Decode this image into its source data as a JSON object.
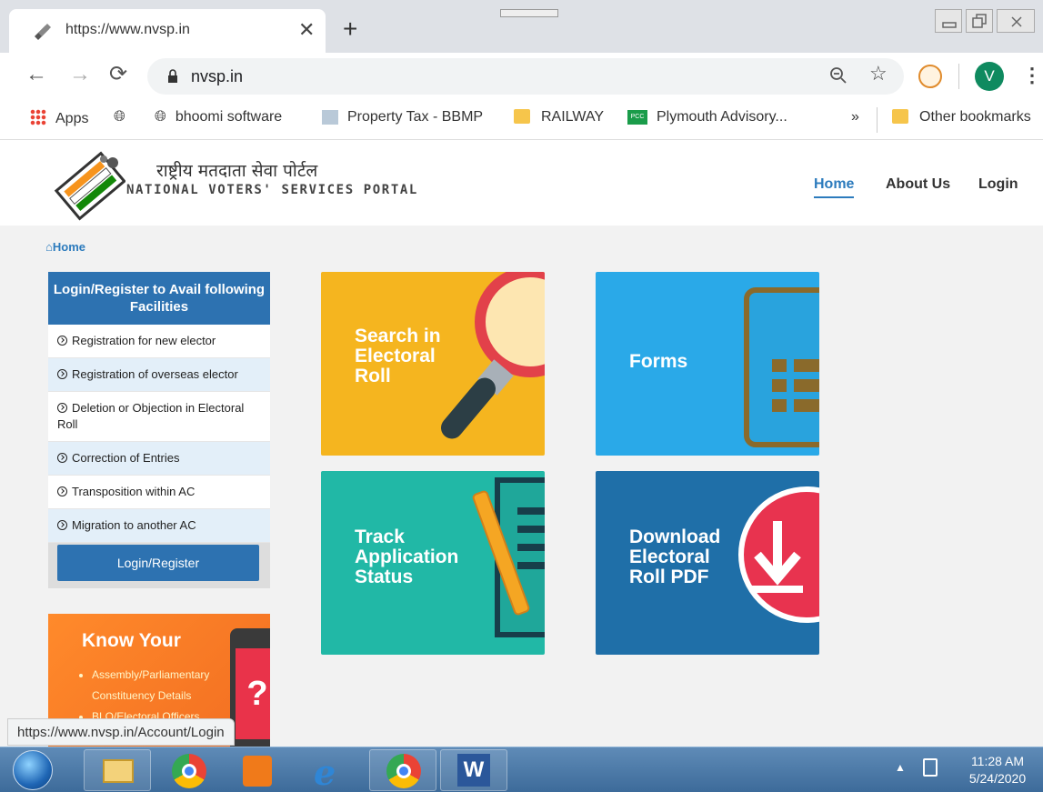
{
  "browser": {
    "tab_title": "https://www.nvsp.in",
    "tab_close": "✕",
    "new_tab": "+",
    "url": "nvsp.in",
    "profile_initial": "V",
    "bookmarks": [
      {
        "label": "Apps"
      },
      {
        "label": "bhoomi software"
      },
      {
        "label": "Property Tax - BBMP"
      },
      {
        "label": "RAILWAY"
      },
      {
        "label": "Plymouth Advisory..."
      },
      {
        "label": "»"
      },
      {
        "label": "Other bookmarks"
      }
    ],
    "status_url": "https://www.nvsp.in/Account/Login"
  },
  "site": {
    "title_hindi": "राष्ट्रीय मतदाता सेवा पोर्टल",
    "title_english": "NATIONAL VOTERS' SERVICES PORTAL",
    "nav": [
      {
        "label": "Home",
        "active": true
      },
      {
        "label": "About Us",
        "active": false
      },
      {
        "label": "Login",
        "active": false
      }
    ],
    "breadcrumb": "Home"
  },
  "login_panel": {
    "heading": "Login/Register to Avail following Facilities",
    "items": [
      "Registration for new elector",
      "Registration of overseas elector",
      "Deletion or Objection in Electoral Roll",
      "Correction of Entries",
      "Transposition within AC",
      "Migration to another AC"
    ],
    "button": "Login/Register"
  },
  "know_your": {
    "title": "Know Your",
    "items": [
      "Assembly/Parliamentary Constituency Details",
      "BLO/Electoral Officers"
    ]
  },
  "tiles": [
    {
      "label": "Search in\nElectoral\nRoll",
      "color": "#f5b51f"
    },
    {
      "label": "Forms",
      "color": "#2aa9e8"
    },
    {
      "label": "Track\nApplication\nStatus",
      "color": "#21b8a6"
    },
    {
      "label": "Download\nElectoral\nRoll PDF",
      "color": "#1f6fa8"
    }
  ],
  "taskbar": {
    "time": "11:28 AM",
    "date": "5/24/2020"
  },
  "colors": {
    "accent_blue": "#2d72b1",
    "link_blue": "#2c7bbd",
    "orange": "#f26d21"
  }
}
